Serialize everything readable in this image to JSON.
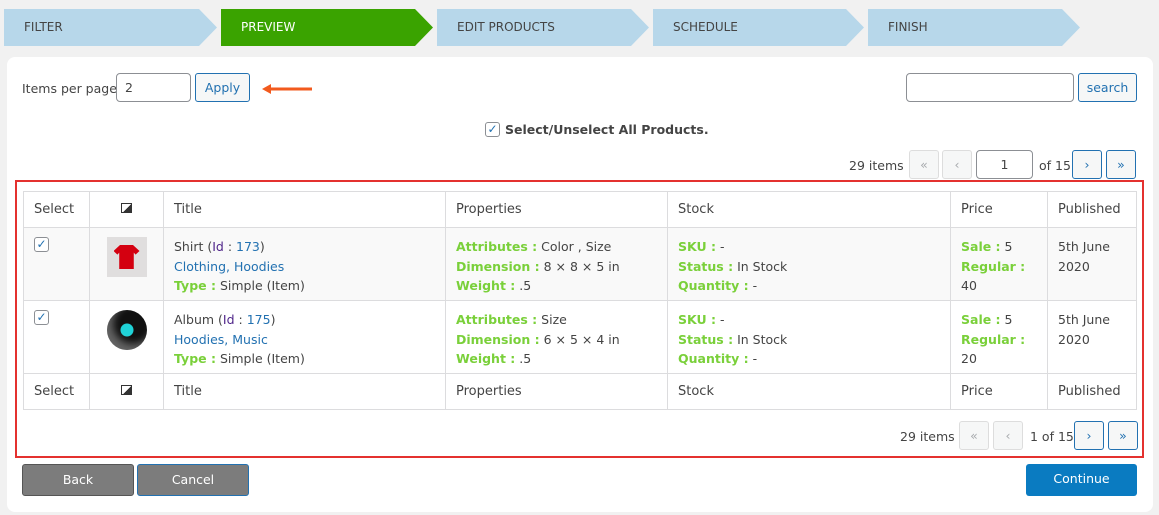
{
  "steps": [
    "FILTER",
    "PREVIEW",
    "EDIT PRODUCTS",
    "SCHEDULE",
    "FINISH"
  ],
  "items_per_page": {
    "label": "Items per page:",
    "value": "2",
    "apply": "Apply"
  },
  "search": {
    "value": "",
    "button": "search"
  },
  "select_all": "Select/Unselect All Products.",
  "pagination_top": {
    "count": "29 items",
    "first": "«",
    "prev": "‹",
    "page": "1",
    "of": "of 15",
    "next": "›",
    "last": "»"
  },
  "pagination_bottom": {
    "count": "29 items",
    "first": "«",
    "prev": "‹",
    "page_text": "1 of 15",
    "next": "›",
    "last": "»"
  },
  "columns": [
    "Select",
    "image-icon",
    "Title",
    "Properties",
    "Stock",
    "Price",
    "Published"
  ],
  "labels": {
    "id": "Id",
    "type": "Type :",
    "attributes": "Attributes :",
    "dimension": "Dimension :",
    "weight": "Weight :",
    "sku": "SKU :",
    "status": "Status :",
    "quantity": "Quantity :",
    "sale": "Sale :",
    "regular": "Regular :"
  },
  "rows": [
    {
      "name": "Shirt",
      "id": "173",
      "categories": "Clothing, Hoodies",
      "type": "Simple (Item)",
      "attributes": "Color , Size",
      "dimension": "8 × 8 × 5 in",
      "weight": ".5",
      "sku": "-",
      "status": "In Stock",
      "quantity": "-",
      "sale": "5",
      "regular": "40",
      "published_1": "5th June",
      "published_2": "2020"
    },
    {
      "name": "Album",
      "id": "175",
      "categories": "Hoodies, Music",
      "type": "Simple (Item)",
      "attributes": "Size",
      "dimension": "6 × 5 × 4 in",
      "weight": ".5",
      "sku": "-",
      "status": "In Stock",
      "quantity": "-",
      "sale": "5",
      "regular": "20",
      "published_1": "5th June",
      "published_2": "2020"
    }
  ],
  "footer": {
    "back": "Back",
    "cancel": "Cancel",
    "continue": "Continue"
  },
  "colors": {
    "active_step": "#3aa300",
    "step": "#b7d7ea",
    "accent": "#2271b1",
    "label_green": "#7ad03a",
    "highlight": "#e4312f"
  }
}
